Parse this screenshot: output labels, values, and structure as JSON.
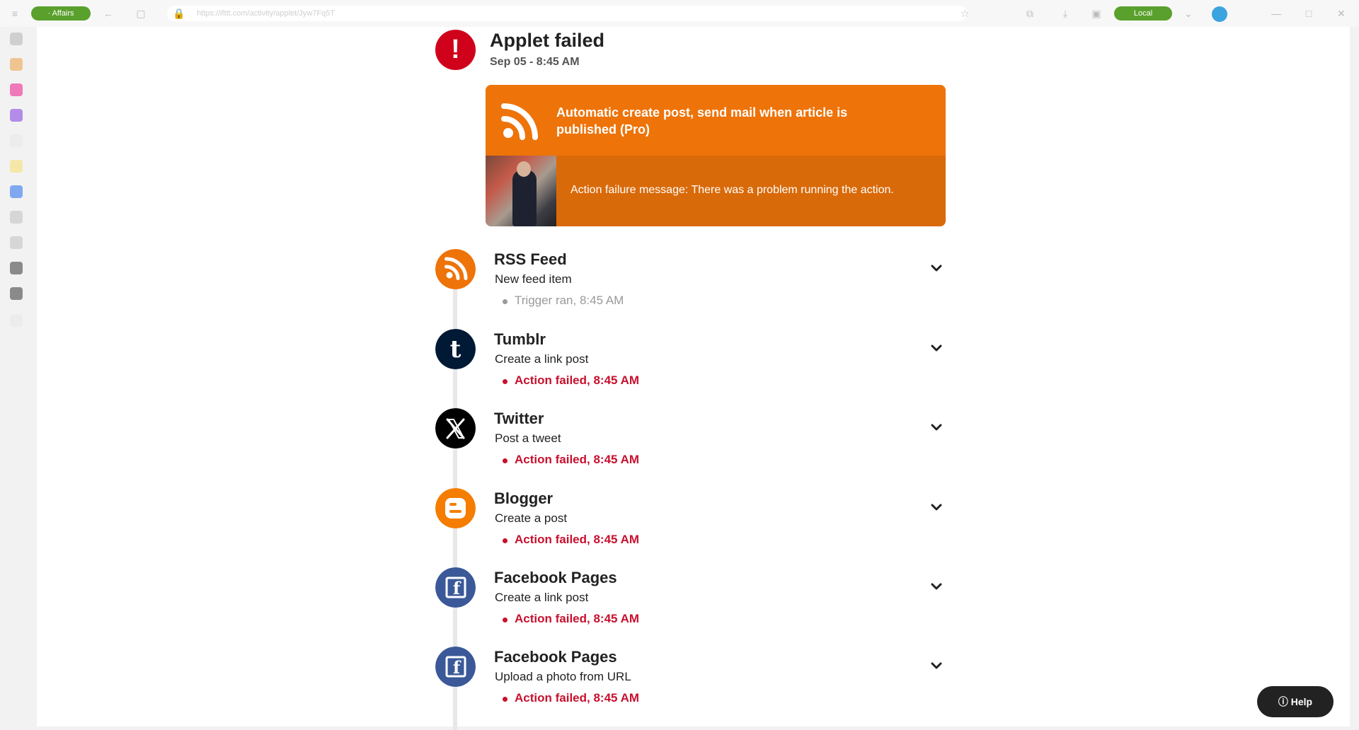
{
  "browser": {
    "left_pill": "· Affairs",
    "url": "https://ifttt.com/activity/applet/Jyw7Fq5T",
    "right_pill": "Local"
  },
  "header": {
    "title": "Applet failed",
    "timestamp": "Sep 05 - 8:45 AM",
    "alert_color": "#d0021b"
  },
  "applet_card": {
    "title": "Automatic create post, send mail when article is published (Pro)",
    "failure_message": "Action failure message: There was a problem running the action.",
    "color": "#ee7309"
  },
  "steps": [
    {
      "service": "RSS Feed",
      "action": "New feed item",
      "status": "Trigger ran, 8:45 AM",
      "state": "ok",
      "icon": "rss-icon"
    },
    {
      "service": "Tumblr",
      "action": "Create a link post",
      "status": "Action failed, 8:45 AM",
      "state": "failed",
      "icon": "tumblr-icon"
    },
    {
      "service": "Twitter",
      "action": "Post a tweet",
      "status": "Action failed, 8:45 AM",
      "state": "failed",
      "icon": "x-twitter-icon"
    },
    {
      "service": "Blogger",
      "action": "Create a post",
      "status": "Action failed, 8:45 AM",
      "state": "failed",
      "icon": "blogger-icon"
    },
    {
      "service": "Facebook Pages",
      "action": "Create a link post",
      "status": "Action failed, 8:45 AM",
      "state": "failed",
      "icon": "facebook-icon"
    },
    {
      "service": "Facebook Pages",
      "action": "Upload a photo from URL",
      "status": "Action failed, 8:45 AM",
      "state": "failed",
      "icon": "facebook-icon"
    }
  ],
  "help": {
    "label": "Help"
  }
}
